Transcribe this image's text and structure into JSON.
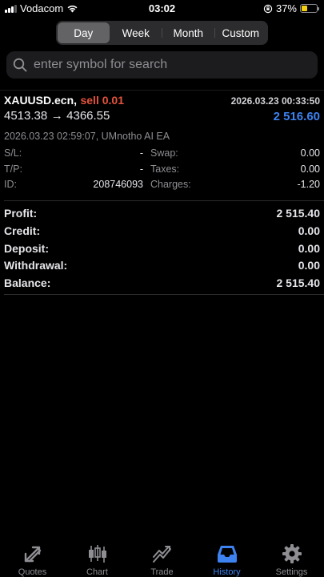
{
  "status_bar": {
    "carrier": "Vodacom",
    "time": "03:02",
    "battery": "37%"
  },
  "periods": [
    {
      "label": "Day",
      "active": true
    },
    {
      "label": "Week",
      "active": false
    },
    {
      "label": "Month",
      "active": false
    },
    {
      "label": "Custom",
      "active": false
    }
  ],
  "search": {
    "placeholder": "enter symbol for search"
  },
  "deal": {
    "symbol": "XAUUSD.ecn,",
    "side": "sell 0.01",
    "close_time": "2026.03.23 00:33:50",
    "open_price": "4513.38",
    "arrow": "→",
    "close_price": "4366.55",
    "profit": "2 516.60",
    "comment": "2026.03.23 02:59:07, UMnotho AI EA",
    "sl": {
      "label": "S/L:",
      "value": "-"
    },
    "tp": {
      "label": "T/P:",
      "value": "-"
    },
    "id": {
      "label": "ID:",
      "value": "208746093"
    },
    "swap": {
      "label": "Swap:",
      "value": "0.00"
    },
    "taxes": {
      "label": "Taxes:",
      "value": "0.00"
    },
    "charges": {
      "label": "Charges:",
      "value": "-1.20"
    }
  },
  "summary": [
    {
      "label": "Profit:",
      "value": "2 515.40"
    },
    {
      "label": "Credit:",
      "value": "0.00"
    },
    {
      "label": "Deposit:",
      "value": "0.00"
    },
    {
      "label": "Withdrawal:",
      "value": "0.00"
    },
    {
      "label": "Balance:",
      "value": "2 515.40"
    }
  ],
  "tabs": [
    {
      "label": "Quotes",
      "icon": "quotes-icon",
      "active": false
    },
    {
      "label": "Chart",
      "icon": "chart-icon",
      "active": false
    },
    {
      "label": "Trade",
      "icon": "trade-icon",
      "active": false
    },
    {
      "label": "History",
      "icon": "history-icon",
      "active": true
    },
    {
      "label": "Settings",
      "icon": "settings-icon",
      "active": false
    }
  ],
  "colors": {
    "accent": "#3d82f0",
    "sell": "#e5533d",
    "background": "#000000",
    "inactive": "#8e8e93"
  }
}
